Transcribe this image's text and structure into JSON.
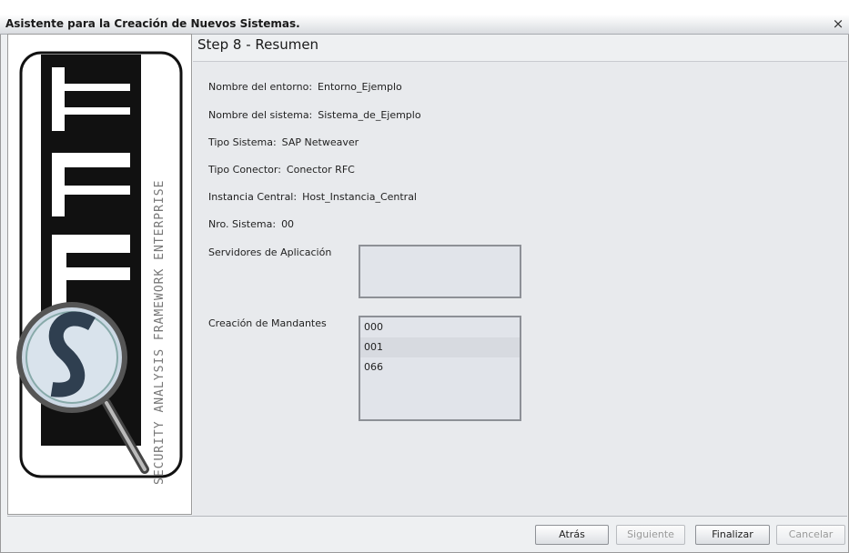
{
  "window": {
    "title": "Asistente para la Creación de Nuevos Sistemas.",
    "close_glyph": "×"
  },
  "logo": {
    "letters": [
      "S",
      "A",
      "F",
      "E"
    ],
    "vertical_text": "SECURITY ANALYSIS FRAMEWORK ENTERPRISE"
  },
  "step": {
    "title": "Step 8 - Resumen"
  },
  "summary": [
    {
      "label": "Nombre del entorno:",
      "value": "Entorno_Ejemplo"
    },
    {
      "label": "Nombre del sistema:",
      "value": "Sistema_de_Ejemplo"
    },
    {
      "label": "Tipo Sistema:",
      "value": "SAP Netweaver"
    },
    {
      "label": "Tipo Conector:",
      "value": "Conector RFC"
    },
    {
      "label": "Instancia Central:",
      "value": "Host_Instancia_Central"
    },
    {
      "label": "Nro. Sistema:",
      "value": "00"
    }
  ],
  "servidores": {
    "label": "Servidores de Aplicación",
    "items": []
  },
  "mandantes": {
    "label": "Creación de Mandantes",
    "items": [
      "000",
      "001",
      "066"
    ]
  },
  "buttons": {
    "back": "Atrás",
    "next": "Siguiente",
    "finish": "Finalizar",
    "cancel": "Cancelar"
  },
  "colors": {
    "logo_dark": "#111111",
    "panel_bg": "#e8eaed"
  }
}
